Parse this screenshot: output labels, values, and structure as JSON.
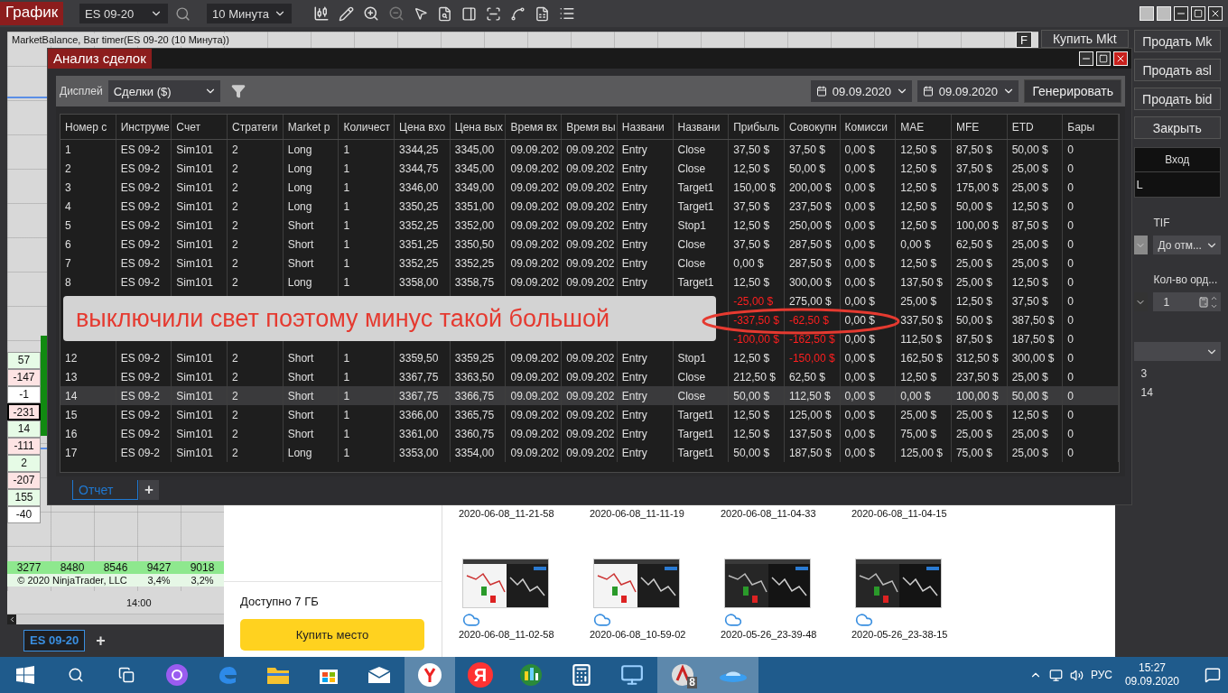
{
  "app": {
    "title_tab": "График",
    "instrument": "ES 09-20",
    "interval": "10 Минута"
  },
  "chart": {
    "title": "MarketBalance, Bar timer(ES 09-20 (10 Минута))",
    "f_button": "F",
    "side_values": [
      {
        "text": "57",
        "kind": "up",
        "outlined": false
      },
      {
        "text": "-147",
        "kind": "down",
        "outlined": false
      },
      {
        "text": "-1",
        "kind": "flat",
        "outlined": false
      },
      {
        "text": "-231",
        "kind": "down",
        "outlined": true
      },
      {
        "text": "14",
        "kind": "up",
        "outlined": false
      },
      {
        "text": "-111",
        "kind": "down",
        "outlined": false
      },
      {
        "text": "2",
        "kind": "up",
        "outlined": false
      },
      {
        "text": "-207",
        "kind": "down",
        "outlined": false
      },
      {
        "text": "155",
        "kind": "up",
        "outlined": false
      },
      {
        "text": "-40",
        "kind": "flat",
        "outlined": false
      }
    ],
    "volume_row": [
      "3277",
      "8480",
      "8546",
      "9427",
      "9018"
    ],
    "copyright": "© 2020 NinjaTrader, LLC",
    "percent_row": [
      "3,4%",
      "3,2%"
    ],
    "time_label": "14:00",
    "tabs": [
      {
        "label": "ES 09-20",
        "selected": true
      }
    ],
    "add_tab": "+"
  },
  "order_panel": {
    "buy_button": "Купить Mkt",
    "buttons": [
      "Продать Mk",
      "Продать asl",
      "Продать bid",
      "Закрыть"
    ],
    "entry_header": "Вход",
    "entry_value": "L",
    "tif_label": "TIF",
    "tif_value": "До отм...",
    "qty_label": "Кол-во орд...",
    "qty_value": "1",
    "list_values": [
      "3",
      "14"
    ]
  },
  "dialog": {
    "title": "Анализ сделок",
    "display_label": "Дисплей",
    "display_value": "Сделки ($)",
    "date_from": "09.09.2020",
    "date_to": "09.09.2020",
    "generate_button": "Генерировать",
    "columns": [
      "Номер с",
      "Инструме",
      "Счет",
      "Стратеги",
      "Market p",
      "Количест",
      "Цена вхо",
      "Цена вых",
      "Время вх",
      "Время вы",
      "Названи",
      "Названи",
      "Прибыль",
      "Совокупн",
      "Комисси",
      "MAE",
      "MFE",
      "ETD",
      "Бары"
    ],
    "rows": [
      {
        "selected": false,
        "profit_negative": false,
        "cumulative_negative": false,
        "cells": [
          "1",
          "ES 09-2",
          "Sim101",
          "2",
          "Long",
          "1",
          "3344,25",
          "3345,00",
          "09.09.202",
          "09.09.202",
          "Entry",
          "Close",
          "37,50 $",
          "37,50 $",
          "0,00 $",
          "12,50 $",
          "87,50 $",
          "50,00 $",
          "0"
        ]
      },
      {
        "selected": false,
        "profit_negative": false,
        "cumulative_negative": false,
        "cells": [
          "2",
          "ES 09-2",
          "Sim101",
          "2",
          "Long",
          "1",
          "3344,75",
          "3345,00",
          "09.09.202",
          "09.09.202",
          "Entry",
          "Close",
          "12,50 $",
          "50,00 $",
          "0,00 $",
          "12,50 $",
          "37,50 $",
          "25,00 $",
          "0"
        ]
      },
      {
        "selected": false,
        "profit_negative": false,
        "cumulative_negative": false,
        "cells": [
          "3",
          "ES 09-2",
          "Sim101",
          "2",
          "Long",
          "1",
          "3346,00",
          "3349,00",
          "09.09.202",
          "09.09.202",
          "Entry",
          "Target1",
          "150,00 $",
          "200,00 $",
          "0,00 $",
          "12,50 $",
          "175,00 $",
          "25,00 $",
          "0"
        ]
      },
      {
        "selected": false,
        "profit_negative": false,
        "cumulative_negative": false,
        "cells": [
          "4",
          "ES 09-2",
          "Sim101",
          "2",
          "Long",
          "1",
          "3350,25",
          "3351,00",
          "09.09.202",
          "09.09.202",
          "Entry",
          "Target1",
          "37,50 $",
          "237,50 $",
          "0,00 $",
          "12,50 $",
          "50,00 $",
          "12,50 $",
          "0"
        ]
      },
      {
        "selected": false,
        "profit_negative": false,
        "cumulative_negative": false,
        "cells": [
          "5",
          "ES 09-2",
          "Sim101",
          "2",
          "Short",
          "1",
          "3352,25",
          "3352,00",
          "09.09.202",
          "09.09.202",
          "Entry",
          "Stop1",
          "12,50 $",
          "250,00 $",
          "0,00 $",
          "12,50 $",
          "100,00 $",
          "87,50 $",
          "0"
        ]
      },
      {
        "selected": false,
        "profit_negative": false,
        "cumulative_negative": false,
        "cells": [
          "6",
          "ES 09-2",
          "Sim101",
          "2",
          "Short",
          "1",
          "3351,25",
          "3350,50",
          "09.09.202",
          "09.09.202",
          "Entry",
          "Close",
          "37,50 $",
          "287,50 $",
          "0,00 $",
          "0,00 $",
          "62,50 $",
          "25,00 $",
          "0"
        ]
      },
      {
        "selected": false,
        "profit_negative": false,
        "cumulative_negative": false,
        "cells": [
          "7",
          "ES 09-2",
          "Sim101",
          "2",
          "Short",
          "1",
          "3352,25",
          "3352,25",
          "09.09.202",
          "09.09.202",
          "Entry",
          "Close",
          "0,00 $",
          "287,50 $",
          "0,00 $",
          "12,50 $",
          "25,00 $",
          "25,00 $",
          "0"
        ]
      },
      {
        "selected": false,
        "profit_negative": false,
        "cumulative_negative": false,
        "cells": [
          "8",
          "ES 09-2",
          "Sim101",
          "2",
          "Long",
          "1",
          "3358,00",
          "3358,75",
          "09.09.202",
          "09.09.202",
          "Entry",
          "Target1",
          "12,50 $",
          "300,00 $",
          "0,00 $",
          "137,50 $",
          "25,00 $",
          "12,50 $",
          "0"
        ]
      },
      {
        "selected": false,
        "profit_negative": true,
        "cumulative_negative": false,
        "cells": [
          "-25,00 $",
          "275,00 $",
          "0,00 $",
          "25,00 $",
          "12,50 $",
          "37,50 $",
          "0"
        ]
      },
      {
        "selected": false,
        "profit_negative": true,
        "cumulative_negative": true,
        "cells": [
          "-337,50 $",
          "-62,50 $",
          "0,00 $",
          "337,50 $",
          "50,00 $",
          "387,50 $",
          "0"
        ]
      },
      {
        "selected": false,
        "profit_negative": true,
        "cumulative_negative": true,
        "cells": [
          "-100,00 $",
          "-162,50 $",
          "0,00 $",
          "112,50 $",
          "87,50 $",
          "187,50 $",
          "0"
        ]
      },
      {
        "selected": false,
        "profit_negative": false,
        "cumulative_negative": true,
        "cells": [
          "12",
          "ES 09-2",
          "Sim101",
          "2",
          "Short",
          "1",
          "3359,50",
          "3359,25",
          "09.09.202",
          "09.09.202",
          "Entry",
          "Stop1",
          "12,50 $",
          "-150,00 $",
          "0,00 $",
          "162,50 $",
          "312,50 $",
          "300,00 $",
          "0"
        ]
      },
      {
        "selected": false,
        "profit_negative": false,
        "cumulative_negative": false,
        "cells": [
          "13",
          "ES 09-2",
          "Sim101",
          "2",
          "Short",
          "1",
          "3367,75",
          "3363,50",
          "09.09.202",
          "09.09.202",
          "Entry",
          "Close",
          "212,50 $",
          "62,50 $",
          "0,00 $",
          "12,50 $",
          "237,50 $",
          "25,00 $",
          "0"
        ]
      },
      {
        "selected": true,
        "profit_negative": false,
        "cumulative_negative": false,
        "cells": [
          "14",
          "ES 09-2",
          "Sim101",
          "2",
          "Short",
          "1",
          "3367,75",
          "3366,75",
          "09.09.202",
          "09.09.202",
          "Entry",
          "Close",
          "50,00 $",
          "112,50 $",
          "0,00 $",
          "0,00 $",
          "100,00 $",
          "50,00 $",
          "0"
        ]
      },
      {
        "selected": false,
        "profit_negative": false,
        "cumulative_negative": false,
        "cells": [
          "15",
          "ES 09-2",
          "Sim101",
          "2",
          "Short",
          "1",
          "3366,00",
          "3365,75",
          "09.09.202",
          "09.09.202",
          "Entry",
          "Target1",
          "12,50 $",
          "125,00 $",
          "0,00 $",
          "25,00 $",
          "25,00 $",
          "12,50 $",
          "0"
        ]
      },
      {
        "selected": false,
        "profit_negative": false,
        "cumulative_negative": false,
        "cells": [
          "16",
          "ES 09-2",
          "Sim101",
          "2",
          "Short",
          "1",
          "3361,00",
          "3360,75",
          "09.09.202",
          "09.09.202",
          "Entry",
          "Target1",
          "12,50 $",
          "137,50 $",
          "0,00 $",
          "75,00 $",
          "25,00 $",
          "25,00 $",
          "0"
        ]
      },
      {
        "selected": false,
        "profit_negative": false,
        "cumulative_negative": false,
        "cells": [
          "17",
          "ES 09-2",
          "Sim101",
          "2",
          "Long",
          "1",
          "3353,00",
          "3354,00",
          "09.09.202",
          "09.09.202",
          "Entry",
          "Target1",
          "50,00 $",
          "187,50 $",
          "0,00 $",
          "125,00 $",
          "75,00 $",
          "25,00 $",
          "0"
        ]
      }
    ],
    "tabs": [
      {
        "label": "Отчет",
        "selected": true
      }
    ],
    "add_tab": "+"
  },
  "annotation": {
    "text": "выключили свет поэтому минус такой большой"
  },
  "storage_window": {
    "top_labels": [
      "2020-06-08_11-21-58",
      "2020-06-08_11-11-19",
      "2020-06-08_11-04-33",
      "2020-06-08_11-04-15"
    ],
    "available": "Доступно 7 ГБ",
    "buy_button": "Купить место",
    "files": [
      {
        "kind": "picture",
        "name": "2020-06-08_11-02-58"
      },
      {
        "kind": "picture",
        "name": "2020-06-08_10-59-02"
      },
      {
        "kind": "picture",
        "name": "2020-05-26_23-39-48"
      },
      {
        "kind": "picture",
        "name": "2020-05-26_23-38-15"
      }
    ]
  },
  "taskbar": {
    "yandex_letter": "Я",
    "ninja_badge": "8",
    "language": "РУС",
    "time": "15:27",
    "date": "09.09.2020"
  }
}
